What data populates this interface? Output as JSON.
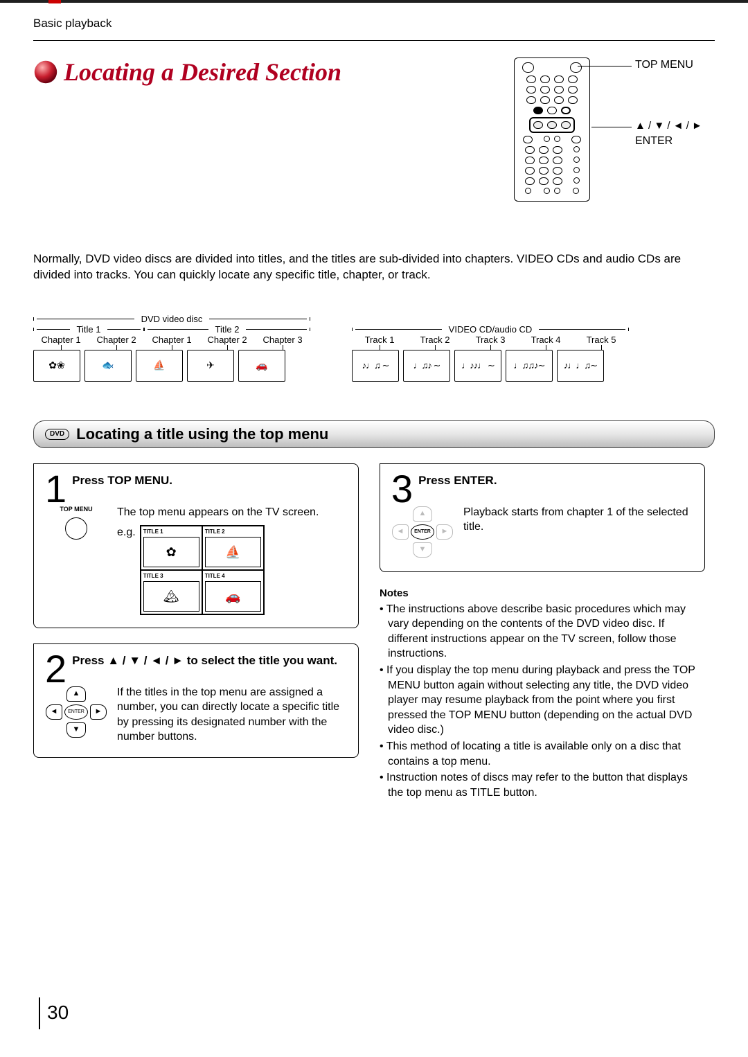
{
  "section_path": "Basic playback",
  "page_title": "Locating a Desired Section",
  "remote_labels": {
    "top_menu": "TOP MENU",
    "dpad": "▲ / ▼ / ◄ / ►",
    "enter": "ENTER"
  },
  "intro": "Normally, DVD video discs are divided into titles, and the titles are sub-divided into chapters. VIDEO CDs and audio CDs are divided into tracks. You can quickly locate any specific title, chapter, or track.",
  "dvd_diagram": {
    "top_label": "DVD video disc",
    "titles": [
      "Title 1",
      "Title 2"
    ],
    "chapters": [
      "Chapter 1",
      "Chapter 2",
      "Chapter 1",
      "Chapter 2",
      "Chapter 3"
    ]
  },
  "cd_diagram": {
    "top_label": "VIDEO CD/audio CD",
    "tracks": [
      "Track 1",
      "Track 2",
      "Track 3",
      "Track 4",
      "Track 5"
    ]
  },
  "section_bar": {
    "badge": "DVD",
    "title": "Locating a title using the top menu"
  },
  "steps": {
    "s1": {
      "num": "1",
      "head": "Press TOP MENU.",
      "icon_label": "TOP MENU",
      "body": "The top menu appears on the TV screen.",
      "eg": "e.g.",
      "thumbs": [
        "TITLE 1",
        "TITLE 2",
        "TITLE 3",
        "TITLE 4"
      ]
    },
    "s2": {
      "num": "2",
      "head_pre": "Press ",
      "head_arrows": "▲ / ▼ / ◄ / ►",
      "head_post": " to select the title you want.",
      "enter_label": "ENTER",
      "body": "If the titles in the top menu are assigned a number, you can directly locate a specific title by pressing its designated number with the number buttons."
    },
    "s3": {
      "num": "3",
      "head": "Press ENTER.",
      "enter_label": "ENTER",
      "body": "Playback starts from chapter 1 of the selected title."
    }
  },
  "notes": {
    "heading": "Notes",
    "items": [
      "The instructions above describe basic procedures which may vary depending on the contents of the DVD video disc. If different instructions appear on the TV screen, follow those instructions.",
      "If you display the top menu during playback and press the TOP MENU button again without selecting any title, the DVD video player may resume playback from the point where you first pressed the TOP MENU button (depending on the actual DVD video disc.)",
      "This method of locating a title is available only on a disc that contains a top menu.",
      "Instruction notes of discs may refer to the button that displays the top menu as TITLE button."
    ]
  },
  "page_number": "30"
}
